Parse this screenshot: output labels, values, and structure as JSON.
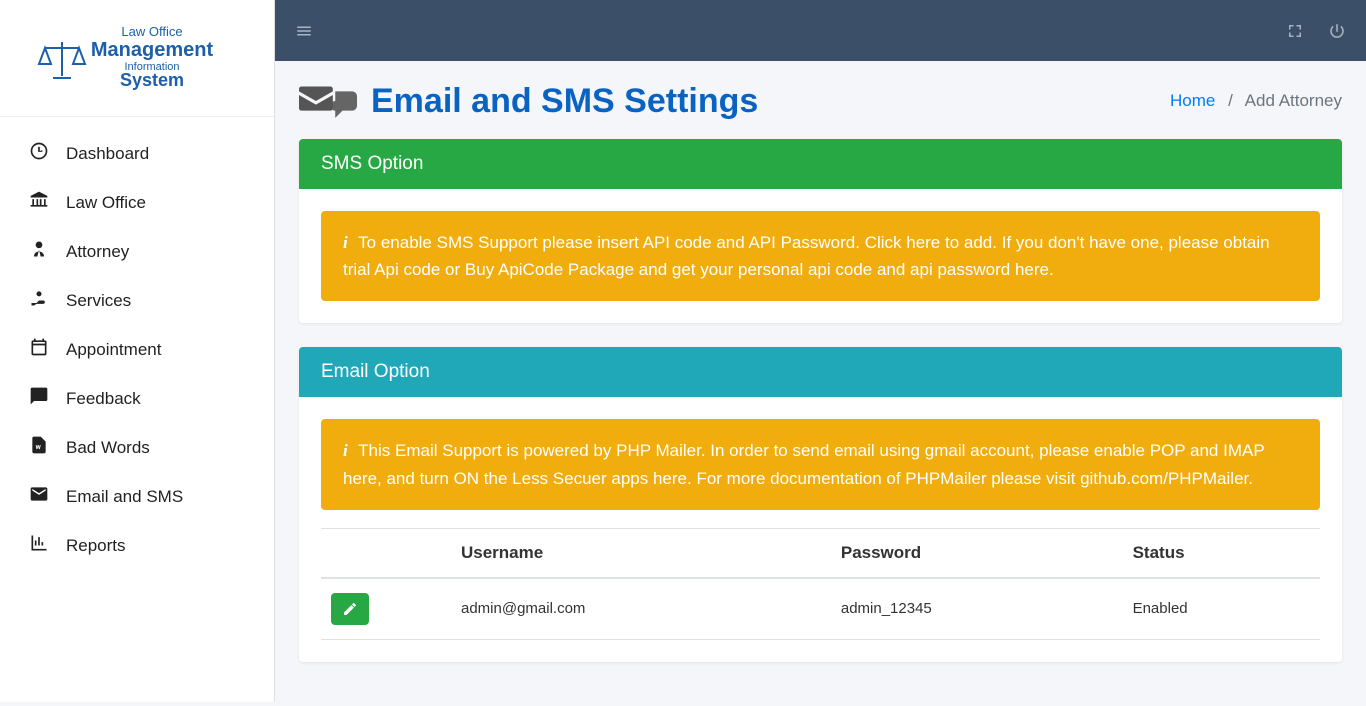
{
  "logo": {
    "line1": "Law Office",
    "line2": "Management",
    "line3": "Information",
    "line4": "System"
  },
  "sidebar": {
    "items": [
      {
        "label": "Dashboard",
        "icon": "dashboard"
      },
      {
        "label": "Law Office",
        "icon": "institution"
      },
      {
        "label": "Attorney",
        "icon": "user-tie"
      },
      {
        "label": "Services",
        "icon": "hand-holding"
      },
      {
        "label": "Appointment",
        "icon": "calendar"
      },
      {
        "label": "Feedback",
        "icon": "comments"
      },
      {
        "label": "Bad Words",
        "icon": "file-word"
      },
      {
        "label": "Email and SMS",
        "icon": "envelope"
      },
      {
        "label": "Reports",
        "icon": "chart-bar"
      }
    ]
  },
  "page": {
    "title": "Email and SMS Settings"
  },
  "breadcrumb": {
    "home": "Home",
    "current": "Add Attorney"
  },
  "sms_card": {
    "title": "SMS Option",
    "alert_pre": "To enable SMS Support please insert API code and API Password. ",
    "alert_link1": "Click here to add.",
    "alert_mid": " If you don't have one, please obtain trial Api code or Buy ApiCode Package and get your personal api code and api password ",
    "alert_link2": "here",
    "alert_post": "."
  },
  "email_card": {
    "title": "Email Option",
    "alert_pre": "This Email Support is powered by PHP Mailer. In order to send email using gmail account, please enable POP and IMAP ",
    "alert_link1": "here",
    "alert_mid1": ", and turn ON the Less Secuer apps ",
    "alert_link2": "here",
    "alert_mid2": ". For more documentation of PHPMailer please visit ",
    "alert_link3": "github.com/PHPMailer",
    "alert_post": ".",
    "table": {
      "headers": {
        "username": "Username",
        "password": "Password",
        "status": "Status"
      },
      "row": {
        "username": "admin@gmail.com",
        "password": "admin_12345",
        "status": "Enabled"
      }
    }
  }
}
